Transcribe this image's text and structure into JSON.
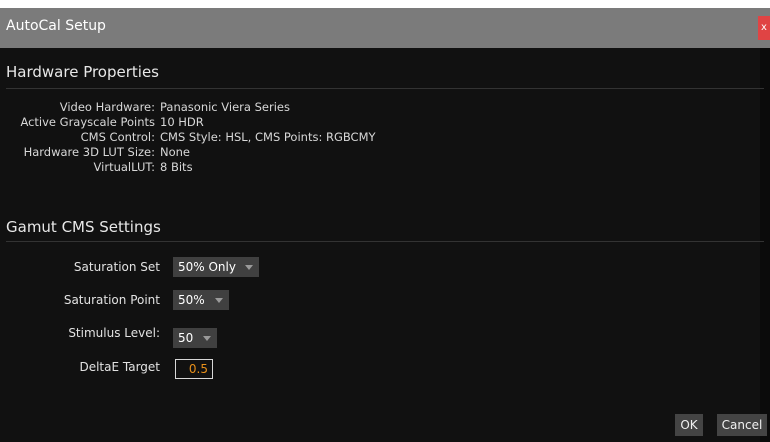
{
  "window": {
    "title": "AutoCal Setup",
    "close_label": "x"
  },
  "hardware": {
    "heading": "Hardware Properties",
    "rows": [
      {
        "label": "Video Hardware:",
        "value": "Panasonic Viera Series"
      },
      {
        "label": "Active Grayscale Points",
        "value": "10 HDR"
      },
      {
        "label": "CMS Control:",
        "value": "CMS Style: HSL, CMS Points: RGBCMY"
      },
      {
        "label": "Hardware 3D LUT Size:",
        "value": "None"
      },
      {
        "label": "VirtualLUT:",
        "value": "8 Bits"
      }
    ]
  },
  "gamut": {
    "heading": "Gamut CMS Settings",
    "saturation_set": {
      "label": "Saturation Set",
      "value": "50% Only"
    },
    "saturation_point": {
      "label": "Saturation Point",
      "value": "50%"
    },
    "stimulus_level": {
      "label": "Stimulus Level:",
      "value": "50"
    },
    "deltae_target": {
      "label": "DeltaE Target",
      "value": "0.5"
    }
  },
  "buttons": {
    "ok": "OK",
    "cancel": "Cancel"
  }
}
